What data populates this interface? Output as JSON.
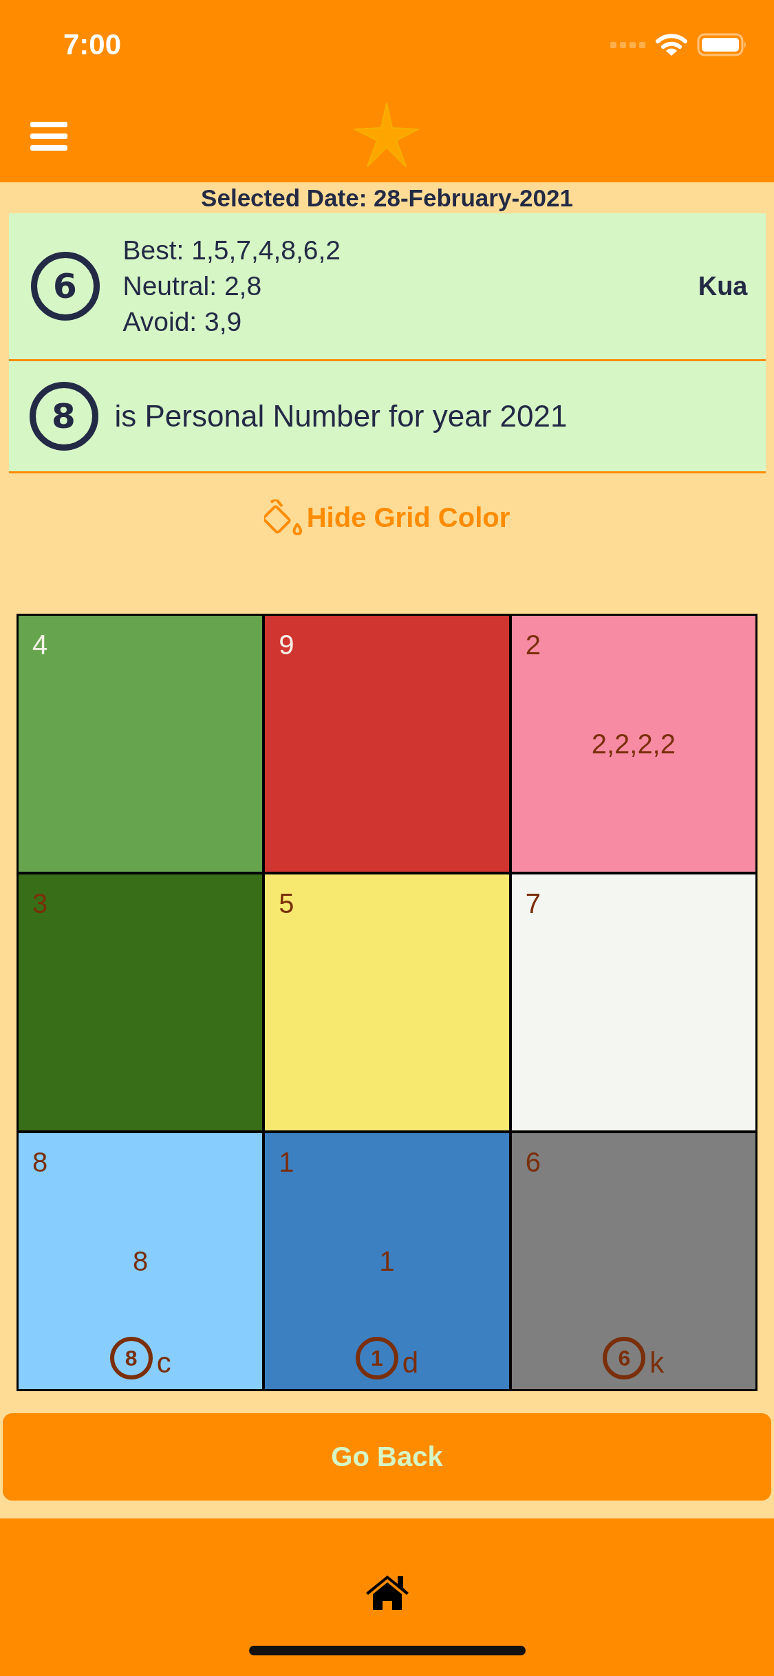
{
  "status_bar": {
    "time": "7:00"
  },
  "selected_date": "Selected Date: 28-February-2021",
  "kua_card": {
    "number": "6",
    "lines": [
      "Best: 1,5,7,4,8,6,2",
      "Neutral: 2,8",
      "Avoid: 3,9"
    ],
    "label": "Kua"
  },
  "personal_card": {
    "number": "8",
    "text": "is Personal Number for year 2021"
  },
  "grid_toggle": {
    "label": "Hide Grid Color"
  },
  "grid": [
    {
      "number": "4",
      "color": "#66a54e",
      "label_light": true
    },
    {
      "number": "9",
      "color": "#d03530",
      "label_light": true
    },
    {
      "number": "2",
      "color": "#f68ba3",
      "label_light": false,
      "center": "2,2,2,2"
    },
    {
      "number": "3",
      "color": "#386e17",
      "label_light": false
    },
    {
      "number": "5",
      "color": "#f7e970",
      "label_light": false
    },
    {
      "number": "7",
      "color": "#f4f6f1",
      "label_light": false
    },
    {
      "number": "8",
      "color": "#87cdfd",
      "label_light": false,
      "center": "8",
      "badge": {
        "digit": "8",
        "letter": "c"
      }
    },
    {
      "number": "1",
      "color": "#3d80c2",
      "label_light": false,
      "center": "1",
      "badge": {
        "digit": "1",
        "letter": "d"
      }
    },
    {
      "number": "6",
      "color": "#7f7f7f",
      "label_light": false,
      "badge": {
        "digit": "6",
        "letter": "k"
      }
    }
  ],
  "go_back": "Go Back"
}
